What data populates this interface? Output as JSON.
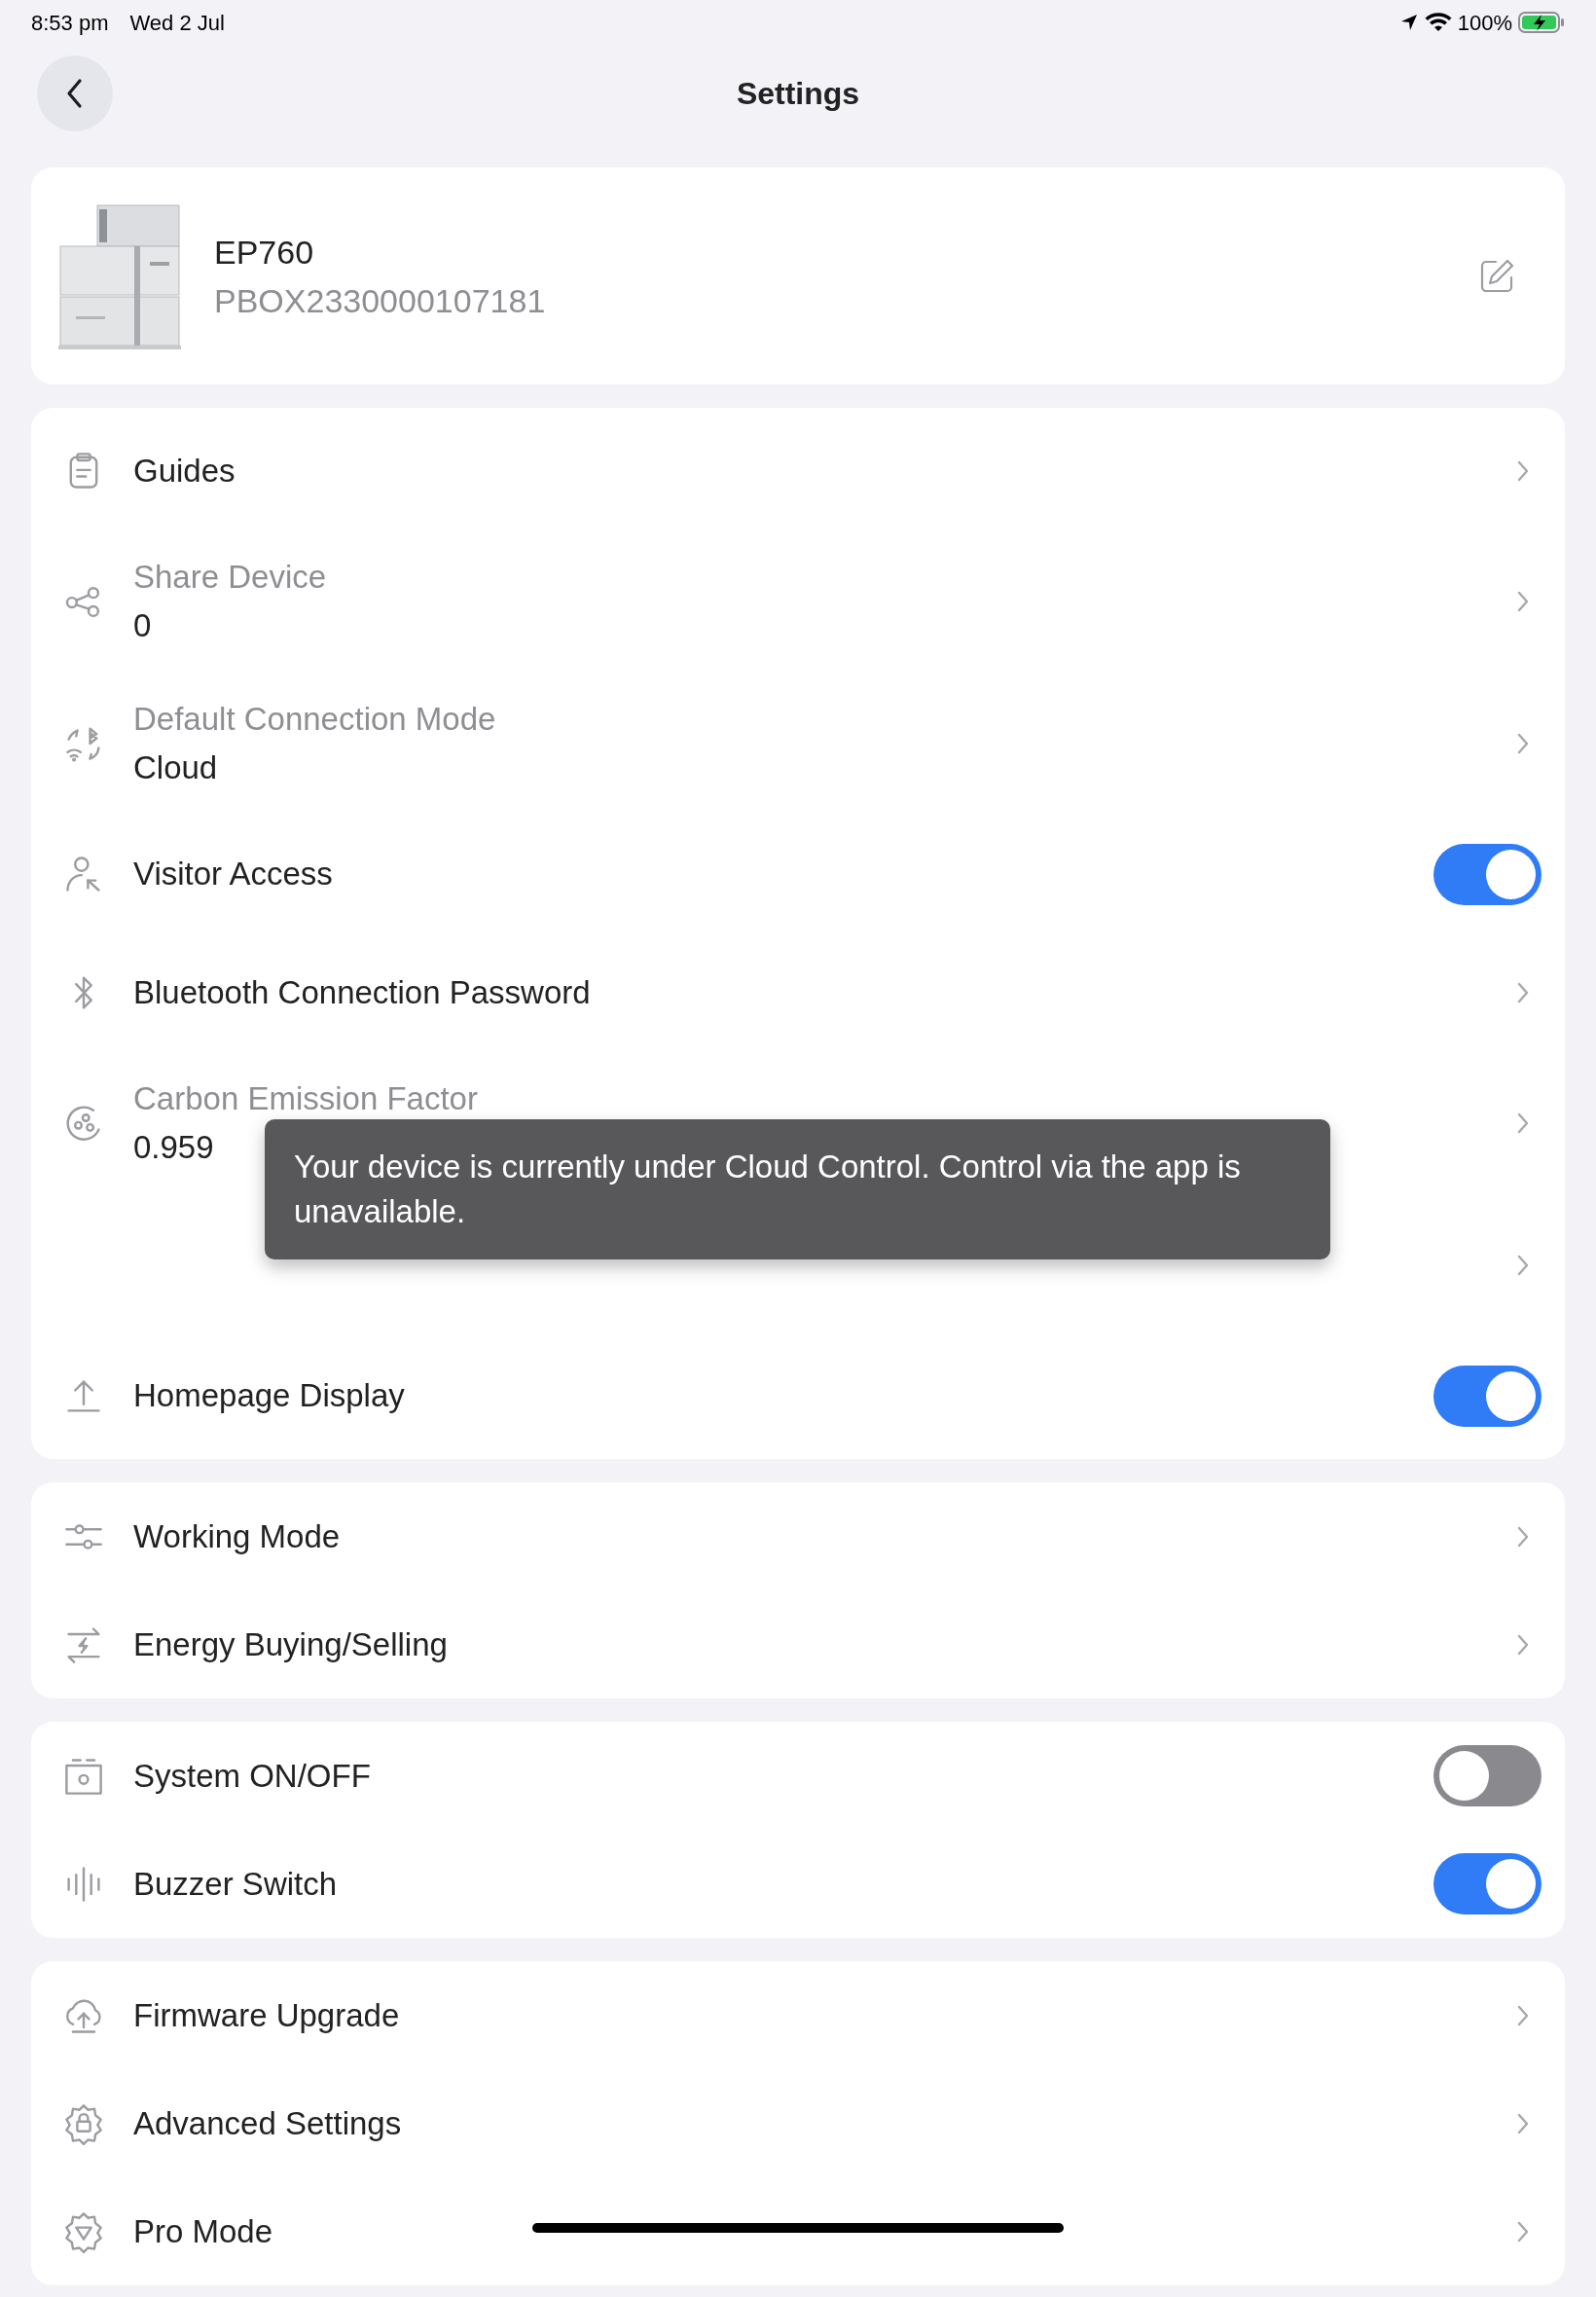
{
  "status_bar": {
    "time": "8:53 pm",
    "date": "Wed 2 Jul",
    "battery": "100%"
  },
  "header": {
    "title": "Settings"
  },
  "device": {
    "name": "EP760",
    "serial": "PBOX2330000107181"
  },
  "sections": [
    {
      "rows": [
        {
          "kind": "link",
          "label": "Guides"
        },
        {
          "kind": "detail",
          "label": "Share Device",
          "value": "0"
        },
        {
          "kind": "detail",
          "label": "Default Connection Mode",
          "value": "Cloud"
        },
        {
          "kind": "toggle",
          "label": "Visitor Access",
          "on": true
        },
        {
          "kind": "link",
          "label": "Bluetooth Connection Password"
        },
        {
          "kind": "detail",
          "label": "Carbon Emission Factor",
          "value": "0.959"
        },
        {
          "kind": "blurred"
        },
        {
          "kind": "toggle",
          "label": "Homepage Display",
          "on": true
        }
      ]
    },
    {
      "rows": [
        {
          "kind": "link",
          "label": "Working Mode"
        },
        {
          "kind": "link",
          "label": "Energy Buying/Selling"
        }
      ]
    },
    {
      "rows": [
        {
          "kind": "toggle",
          "label": "System ON/OFF",
          "on": false
        },
        {
          "kind": "toggle",
          "label": "Buzzer Switch",
          "on": true
        }
      ]
    },
    {
      "rows": [
        {
          "kind": "link",
          "label": "Firmware Upgrade"
        },
        {
          "kind": "link",
          "label": "Advanced Settings"
        },
        {
          "kind": "link",
          "label": "Pro Mode"
        }
      ]
    }
  ],
  "toast": {
    "text": "Your device is currently under Cloud Control. Control via the app is unavailable."
  }
}
